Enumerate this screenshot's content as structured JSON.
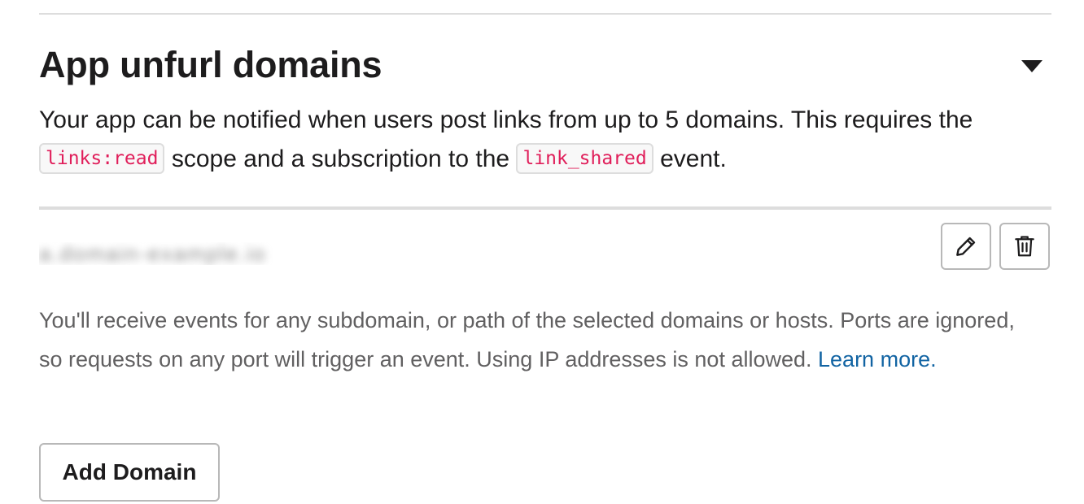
{
  "section": {
    "title": "App unfurl domains",
    "toggle_icon": "caret-down-icon",
    "description": {
      "part1": "Your app can be notified when users post links from up to 5 domains. This requires the ",
      "code1": "links:read",
      "part2": " scope and a subscription to the ",
      "code2": "link_shared",
      "part3": " event."
    }
  },
  "domains": [
    {
      "value": "a.domain-example.io"
    }
  ],
  "actions": {
    "edit_icon": "pencil-icon",
    "delete_icon": "trash-icon"
  },
  "help": {
    "text": "You'll receive events for any subdomain, or path of the selected domains or hosts. Ports are ignored, so requests on any port will trigger an event. Using IP addresses is not allowed. ",
    "link_label": "Learn more."
  },
  "add_domain_label": "Add Domain",
  "colors": {
    "code_text": "#e01e5a",
    "link": "#1264a3",
    "body_text": "#1d1c1d",
    "muted_text": "#616061"
  }
}
